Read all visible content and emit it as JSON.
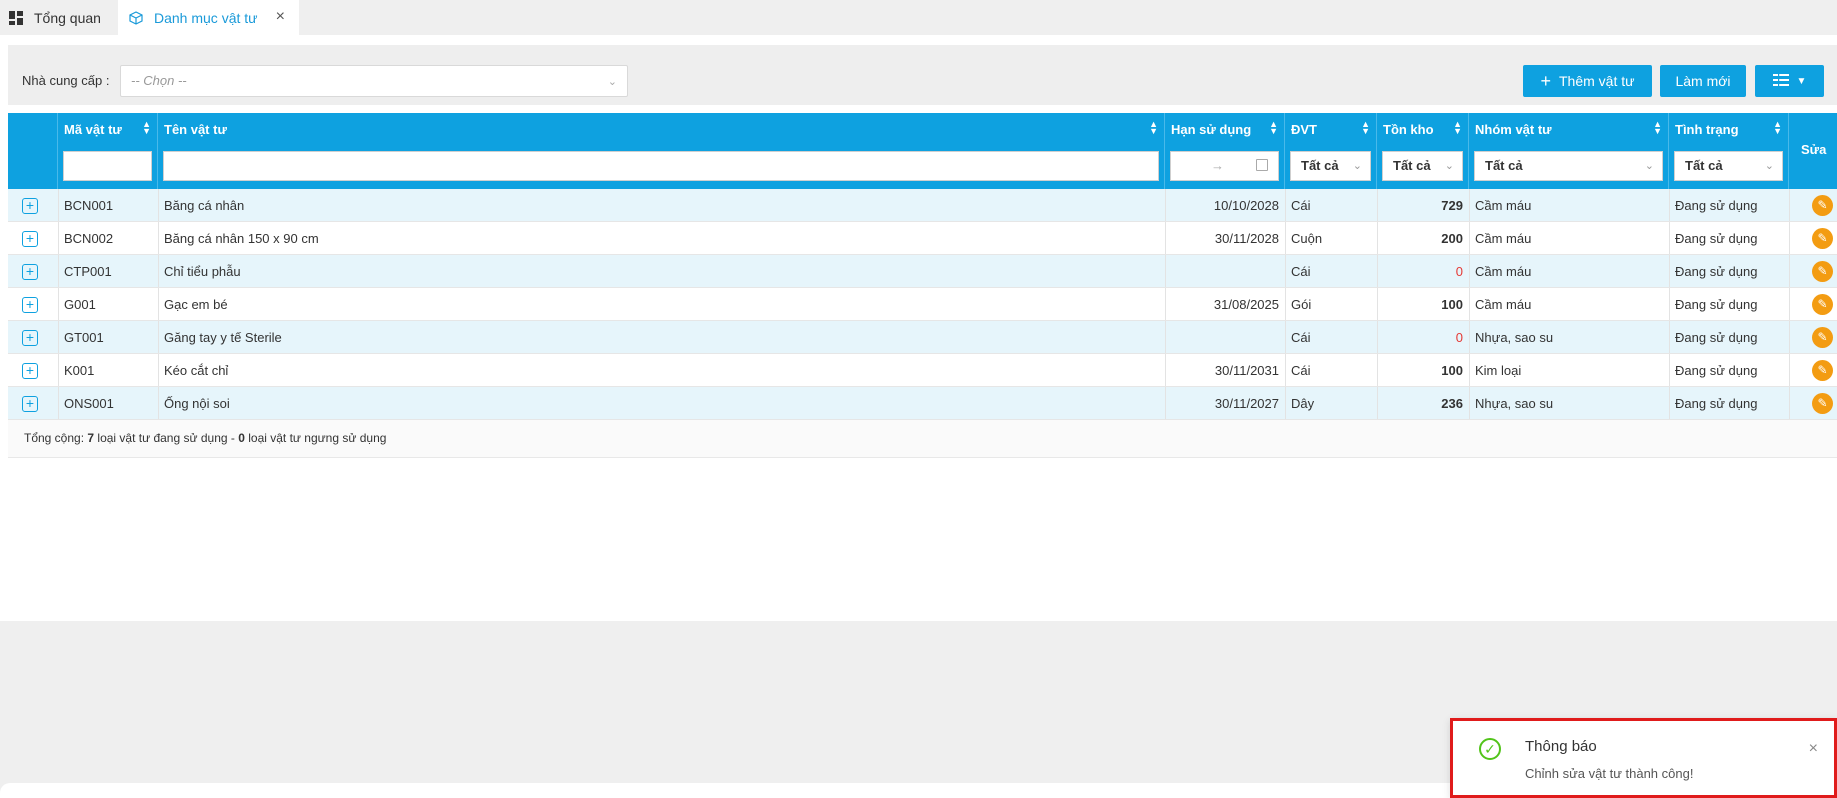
{
  "tabs": [
    {
      "label": "Tổng quan",
      "icon": "dashboard-icon"
    },
    {
      "label": "Danh mục vật tư",
      "icon": "box-icon",
      "active": true,
      "close": "×"
    }
  ],
  "toolbar": {
    "supplier_label": "Nhà cung cấp :",
    "supplier_placeholder": "-- Chọn --",
    "add_label": "Thêm vật tư",
    "refresh_label": "Làm mới",
    "columns_icon": "column-settings-icon"
  },
  "table": {
    "columns": {
      "code": "Mã vật tư",
      "name": "Tên vật tư",
      "expiry": "Hạn sử dụng",
      "unit": "ĐVT",
      "stock": "Tồn kho",
      "group": "Nhóm vật tư",
      "status": "Tình trạng",
      "edit": "Sửa"
    },
    "filters": {
      "unit": "Tất cả",
      "stock": "Tất cả",
      "group": "Tất cả",
      "status": "Tất cả",
      "date_arrow": "→"
    },
    "rows": [
      {
        "code": "BCN001",
        "name": "Băng cá nhân",
        "expiry": "10/10/2028",
        "unit": "Cái",
        "stock": "729",
        "group": "Cầm máu",
        "status": "Đang sử dụng"
      },
      {
        "code": "BCN002",
        "name": "Băng cá nhân 150 x 90 cm",
        "expiry": "30/11/2028",
        "unit": "Cuộn",
        "stock": "200",
        "group": "Cầm máu",
        "status": "Đang sử dụng"
      },
      {
        "code": "CTP001",
        "name": "Chỉ tiểu phẫu",
        "expiry": "",
        "unit": "Cái",
        "stock": "0",
        "group": "Cầm máu",
        "status": "Đang sử dụng"
      },
      {
        "code": "G001",
        "name": "Gạc em bé",
        "expiry": "31/08/2025",
        "unit": "Gói",
        "stock": "100",
        "group": "Cầm máu",
        "status": "Đang sử dụng"
      },
      {
        "code": "GT001",
        "name": "Găng tay y tế Sterile",
        "expiry": "",
        "unit": "Cái",
        "stock": "0",
        "group": "Nhựa, sao su",
        "status": "Đang sử dụng"
      },
      {
        "code": "K001",
        "name": "Kéo cắt chỉ",
        "expiry": "30/11/2031",
        "unit": "Cái",
        "stock": "100",
        "group": "Kim loại",
        "status": "Đang sử dụng"
      },
      {
        "code": "ONS001",
        "name": "Ống nội soi",
        "expiry": "30/11/2027",
        "unit": "Dây",
        "stock": "236",
        "group": "Nhựa, sao su",
        "status": "Đang sử dụng"
      }
    ],
    "footer": {
      "prefix": "Tổng cộng: ",
      "active_count": "7",
      "middle": " loại vật tư đang sử dụng - ",
      "inactive_count": "0",
      "suffix": " loại vật tư ngưng sử dụng"
    }
  },
  "toast": {
    "title": "Thông báo",
    "message": "Chỉnh sửa vật tư thành công!",
    "icon": "check-circle-icon",
    "close": "×"
  },
  "colors": {
    "primary": "#0ea1e0",
    "row_alt": "#e6f5fb",
    "edit_button": "#f39c12",
    "zero_stock": "#e53935",
    "toast_border": "#e01b1b",
    "success": "#52c41a"
  }
}
